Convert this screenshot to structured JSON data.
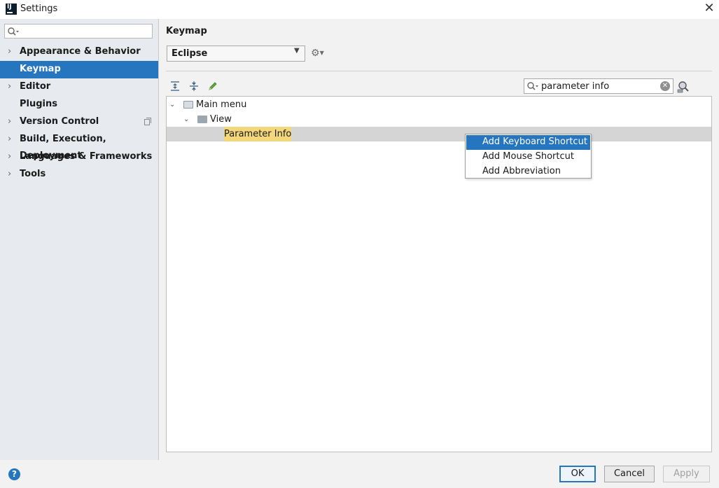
{
  "window": {
    "title": "Settings",
    "app_icon_text": "IJ"
  },
  "sidebar": {
    "search": {
      "value": "",
      "placeholder": ""
    },
    "items": [
      {
        "label": "Appearance & Behavior",
        "expandable": true,
        "selected": false
      },
      {
        "label": "Keymap",
        "expandable": false,
        "selected": true
      },
      {
        "label": "Editor",
        "expandable": true,
        "selected": false
      },
      {
        "label": "Plugins",
        "expandable": false,
        "selected": false
      },
      {
        "label": "Version Control",
        "expandable": true,
        "selected": false,
        "icon": "project-scope-icon"
      },
      {
        "label": "Build, Execution, Deployment",
        "expandable": true,
        "selected": false
      },
      {
        "label": "Languages & Frameworks",
        "expandable": true,
        "selected": false
      },
      {
        "label": "Tools",
        "expandable": true,
        "selected": false
      }
    ]
  },
  "main": {
    "title": "Keymap",
    "keymap_select": {
      "value": "Eclipse"
    },
    "toolbar": {
      "icons": [
        "expand-all-icon",
        "collapse-all-icon",
        "edit-icon",
        "gear-icon",
        "find-shortcut-icon"
      ]
    },
    "filter": {
      "value": "parameter info"
    },
    "tree": [
      {
        "label": "Main menu",
        "level": 0,
        "expanded": true,
        "icon": "menu-folder-icon"
      },
      {
        "label": "View",
        "level": 1,
        "expanded": true,
        "icon": "folder-icon"
      },
      {
        "label": "Parameter Info",
        "level": 2,
        "selected": true,
        "match": true
      }
    ]
  },
  "context_menu": {
    "items": [
      {
        "label": "Add Keyboard Shortcut",
        "active": true
      },
      {
        "label": "Add Mouse Shortcut",
        "active": false
      },
      {
        "label": "Add Abbreviation",
        "active": false
      }
    ]
  },
  "footer": {
    "help_label": "?",
    "ok_label": "OK",
    "cancel_label": "Cancel",
    "apply_label": "Apply"
  },
  "colors": {
    "accent": "#2675bf",
    "sidebar_bg": "#e7ebf0",
    "match_highlight": "#f4d77a"
  }
}
